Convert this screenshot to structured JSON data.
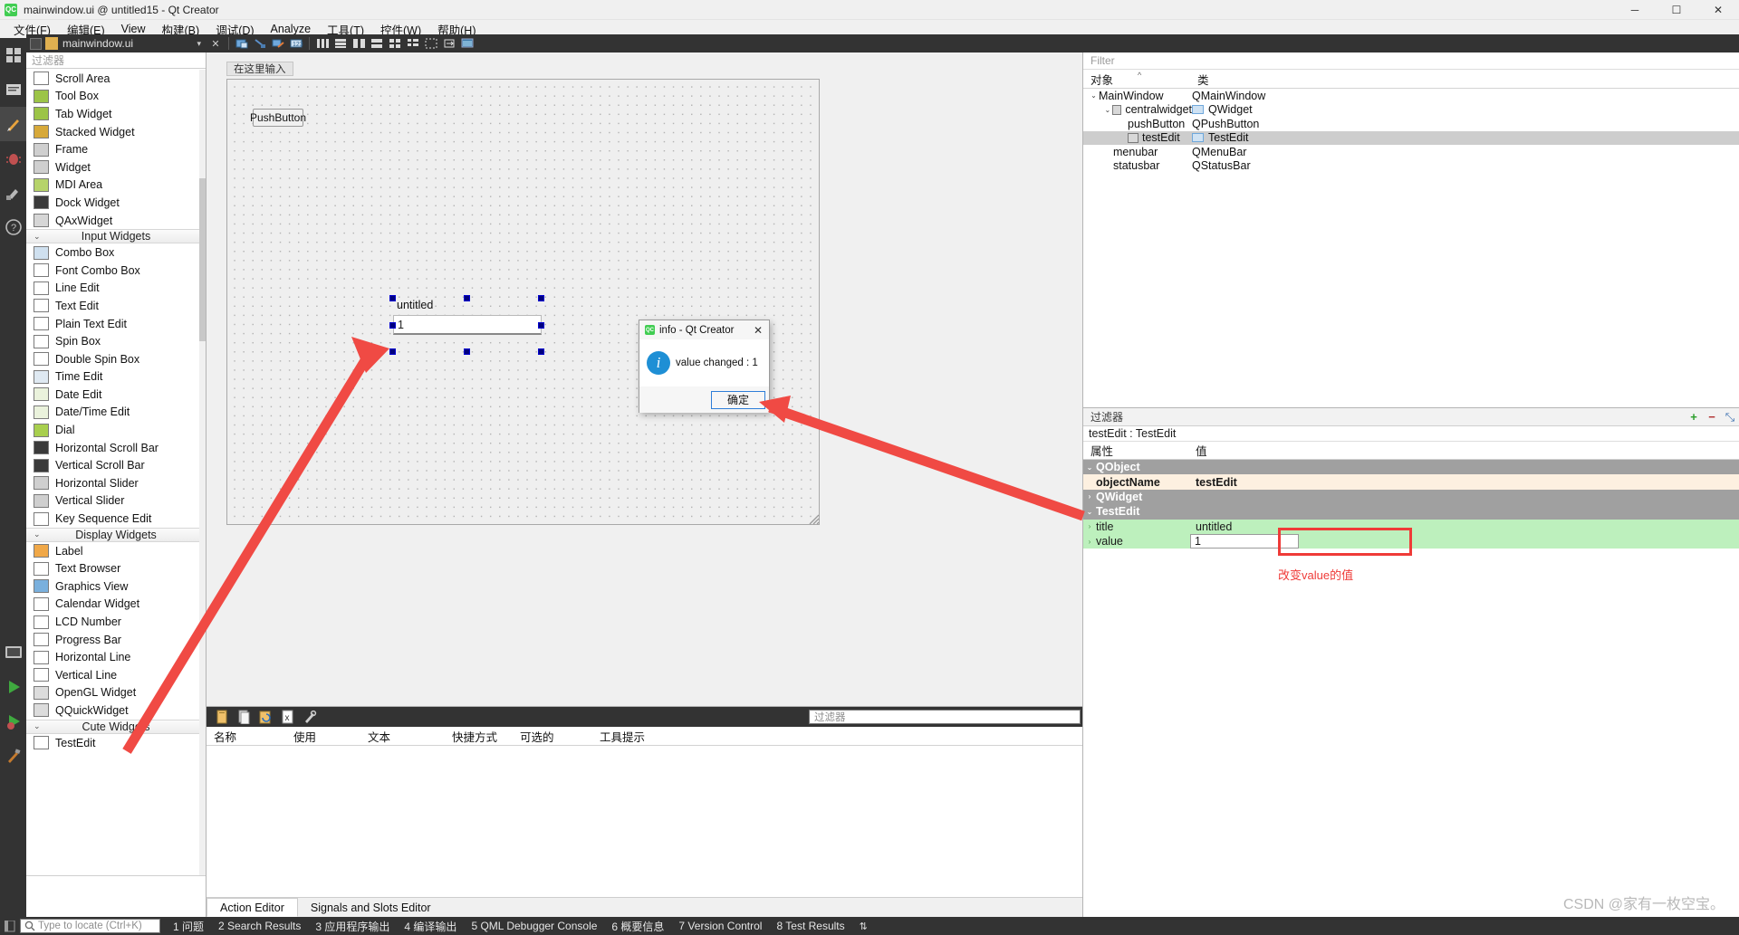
{
  "window": {
    "title": "mainwindow.ui @ untitled15 - Qt Creator",
    "logo": "qt-creator-logo",
    "minimize": "─",
    "maximize": "☐",
    "close": "✕"
  },
  "menubar": {
    "items": [
      {
        "label": "文件(F)",
        "name": "menu-file"
      },
      {
        "label": "编辑(E)",
        "name": "menu-edit"
      },
      {
        "label": "View",
        "name": "menu-view"
      },
      {
        "label": "构建(B)",
        "name": "menu-build"
      },
      {
        "label": "调试(D)",
        "name": "menu-debug"
      },
      {
        "label": "Analyze",
        "name": "menu-analyze"
      },
      {
        "label": "工具(T)",
        "name": "menu-tools"
      },
      {
        "label": "控件(W)",
        "name": "menu-widget"
      },
      {
        "label": "帮助(H)",
        "name": "menu-help"
      }
    ]
  },
  "editor_toolbar": {
    "file_tab": "mainwindow.ui",
    "dropdown": "▾",
    "close": "✕",
    "icons": [
      "edit-widgets-icon",
      "edit-signals-slots-icon",
      "edit-buddies-icon",
      "edit-tab-order-icon",
      "layout-horizontal-icon",
      "layout-vertical-icon",
      "layout-splitter-horizontal-icon",
      "layout-splitter-vertical-icon",
      "layout-grid-icon",
      "layout-form-icon",
      "break-layout-icon",
      "adjust-size-icon",
      "preview-icon"
    ]
  },
  "activity_bar": {
    "items": [
      {
        "name": "welcome-icon",
        "glyph": "⊞"
      },
      {
        "name": "edit-icon",
        "glyph": "▤"
      },
      {
        "name": "design-icon",
        "glyph": "✎"
      },
      {
        "name": "debug-icon",
        "glyph": "ὁe"
      },
      {
        "name": "projects-icon",
        "glyph": "⚒"
      },
      {
        "name": "help-icon",
        "glyph": "?"
      },
      {
        "name": "project-selector-icon",
        "glyph": "▣"
      },
      {
        "name": "run-icon",
        "glyph": "▶"
      },
      {
        "name": "debug-run-icon",
        "glyph": "▶"
      },
      {
        "name": "build-icon",
        "glyph": "⚒"
      }
    ]
  },
  "widget_box": {
    "filter_placeholder": "过滤器",
    "groups": [
      {
        "header": null,
        "items": [
          {
            "label": "Scroll Area",
            "icon": "scroll-area-icon"
          },
          {
            "label": "Tool Box",
            "icon": "tool-box-icon"
          },
          {
            "label": "Tab Widget",
            "icon": "tab-widget-icon"
          },
          {
            "label": "Stacked Widget",
            "icon": "stacked-widget-icon"
          },
          {
            "label": "Frame",
            "icon": "frame-icon"
          },
          {
            "label": "Widget",
            "icon": "widget-icon"
          },
          {
            "label": "MDI Area",
            "icon": "mdi-area-icon"
          },
          {
            "label": "Dock Widget",
            "icon": "dock-widget-icon"
          },
          {
            "label": "QAxWidget",
            "icon": "qax-widget-icon"
          }
        ]
      },
      {
        "header": "Input Widgets",
        "items": [
          {
            "label": "Combo Box",
            "icon": "combo-box-icon"
          },
          {
            "label": "Font Combo Box",
            "icon": "font-combo-box-icon"
          },
          {
            "label": "Line Edit",
            "icon": "line-edit-icon"
          },
          {
            "label": "Text Edit",
            "icon": "text-edit-icon"
          },
          {
            "label": "Plain Text Edit",
            "icon": "plain-text-edit-icon"
          },
          {
            "label": "Spin Box",
            "icon": "spin-box-icon"
          },
          {
            "label": "Double Spin Box",
            "icon": "double-spin-box-icon"
          },
          {
            "label": "Time Edit",
            "icon": "time-edit-icon"
          },
          {
            "label": "Date Edit",
            "icon": "date-edit-icon"
          },
          {
            "label": "Date/Time Edit",
            "icon": "date-time-edit-icon"
          },
          {
            "label": "Dial",
            "icon": "dial-icon"
          },
          {
            "label": "Horizontal Scroll Bar",
            "icon": "horizontal-scroll-bar-icon"
          },
          {
            "label": "Vertical Scroll Bar",
            "icon": "vertical-scroll-bar-icon"
          },
          {
            "label": "Horizontal Slider",
            "icon": "horizontal-slider-icon"
          },
          {
            "label": "Vertical Slider",
            "icon": "vertical-slider-icon"
          },
          {
            "label": "Key Sequence Edit",
            "icon": "key-sequence-edit-icon"
          }
        ]
      },
      {
        "header": "Display Widgets",
        "items": [
          {
            "label": "Label",
            "icon": "label-icon"
          },
          {
            "label": "Text Browser",
            "icon": "text-browser-icon"
          },
          {
            "label": "Graphics View",
            "icon": "graphics-view-icon"
          },
          {
            "label": "Calendar Widget",
            "icon": "calendar-widget-icon"
          },
          {
            "label": "LCD Number",
            "icon": "lcd-number-icon"
          },
          {
            "label": "Progress Bar",
            "icon": "progress-bar-icon"
          },
          {
            "label": "Horizontal Line",
            "icon": "horizontal-line-icon"
          },
          {
            "label": "Vertical Line",
            "icon": "vertical-line-icon"
          },
          {
            "label": "OpenGL Widget",
            "icon": "opengl-widget-icon"
          },
          {
            "label": "QQuickWidget",
            "icon": "qquick-widget-icon"
          }
        ]
      },
      {
        "header": "Cute Widgets",
        "items": [
          {
            "label": "TestEdit",
            "icon": "test-edit-icon"
          }
        ]
      }
    ]
  },
  "form_editor": {
    "hint": "在这里输入",
    "push_button": "PushButton",
    "test_edit": {
      "title": "untitled",
      "value": "1"
    }
  },
  "action_editor": {
    "filter_placeholder": "过滤器",
    "toolbar_icons": [
      "new-action-icon",
      "copy-icon",
      "paste-icon",
      "delete-icon",
      "configure-icon"
    ],
    "columns": [
      "名称",
      "使用",
      "文本",
      "快捷方式",
      "可选的",
      "工具提示"
    ],
    "tabs": [
      {
        "label": "Action Editor",
        "active": true
      },
      {
        "label": "Signals and Slots Editor",
        "active": false
      }
    ]
  },
  "object_inspector": {
    "filter_placeholder": "Filter",
    "columns": [
      "对象",
      "类"
    ],
    "rows": [
      {
        "object": "MainWindow",
        "class": "QMainWindow",
        "indent": 0,
        "expander": "⌄",
        "selected": false,
        "icon": null
      },
      {
        "object": "centralwidget",
        "class": "QWidget",
        "indent": 1,
        "expander": "⌄",
        "selected": false,
        "icon": "no-layout-icon"
      },
      {
        "object": "pushButton",
        "class": "QPushButton",
        "indent": 2,
        "expander": "",
        "selected": false,
        "icon": null
      },
      {
        "object": "testEdit",
        "class": "TestEdit",
        "indent": 2,
        "expander": "",
        "selected": true,
        "icon": "test-edit-icon"
      },
      {
        "object": "menubar",
        "class": "QMenuBar",
        "indent": 1,
        "expander": "",
        "selected": false,
        "icon": null
      },
      {
        "object": "statusbar",
        "class": "QStatusBar",
        "indent": 1,
        "expander": "",
        "selected": false,
        "icon": null
      }
    ]
  },
  "property_editor": {
    "filter_placeholder": "过滤器",
    "add_button": "+",
    "remove_button": "−",
    "configure_button": "⤡",
    "object_header": "testEdit : TestEdit",
    "columns": [
      "属性",
      "值"
    ],
    "rows": [
      {
        "key": "QObject",
        "value": "",
        "style": "group",
        "expander": "⌄"
      },
      {
        "key": "objectName",
        "value": "testEdit",
        "style": "alt",
        "expander": ""
      },
      {
        "key": "QWidget",
        "value": "",
        "style": "group",
        "expander": "›"
      },
      {
        "key": "TestEdit",
        "value": "",
        "style": "group",
        "expander": "⌄"
      },
      {
        "key": "title",
        "value": "untitled",
        "style": "green",
        "expander": "›"
      },
      {
        "key": "value",
        "value": "1",
        "style": "green",
        "expander": "›",
        "editing": true
      }
    ],
    "annotation": "改变value的值",
    "highlight_color": "#ef3b38"
  },
  "dialog": {
    "title": "info - Qt Creator",
    "close": "✕",
    "icon": "info-icon",
    "message": "value changed : 1",
    "ok_button": "确定"
  },
  "status_bar": {
    "locator_placeholder": "Type to locate (Ctrl+K)",
    "search_icon": "search-icon",
    "items": [
      "1 问题",
      "2 Search Results",
      "3 应用程序输出",
      "4 编译输出",
      "5 QML Debugger Console",
      "6 概要信息",
      "7 Version Control",
      "8 Test Results"
    ],
    "updown": "⇅"
  },
  "watermark": "CSDN @家有一枚空宝。"
}
